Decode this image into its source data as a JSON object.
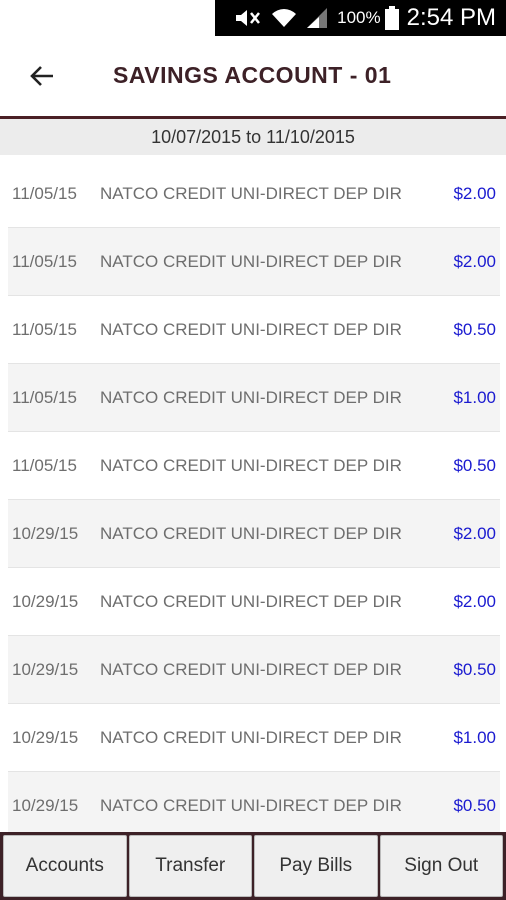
{
  "status_bar": {
    "battery_percent": "100%",
    "time": "2:54 PM",
    "icons": [
      "mute-icon",
      "wifi-icon",
      "signal-icon",
      "battery-icon"
    ]
  },
  "header": {
    "title": "SAVINGS ACCOUNT - 01",
    "back_icon": "arrow-left-icon"
  },
  "date_range": "10/07/2015 to 11/10/2015",
  "transactions": [
    {
      "date": "11/05/15",
      "description": "NATCO CREDIT UNI-DIRECT DEP DIR",
      "amount": "$2.00"
    },
    {
      "date": "11/05/15",
      "description": "NATCO CREDIT UNI-DIRECT DEP DIR",
      "amount": "$2.00"
    },
    {
      "date": "11/05/15",
      "description": "NATCO CREDIT UNI-DIRECT DEP DIR",
      "amount": "$0.50"
    },
    {
      "date": "11/05/15",
      "description": "NATCO CREDIT UNI-DIRECT DEP DIR",
      "amount": "$1.00"
    },
    {
      "date": "11/05/15",
      "description": "NATCO CREDIT UNI-DIRECT DEP DIR",
      "amount": "$0.50"
    },
    {
      "date": "10/29/15",
      "description": "NATCO CREDIT UNI-DIRECT DEP DIR",
      "amount": "$2.00"
    },
    {
      "date": "10/29/15",
      "description": "NATCO CREDIT UNI-DIRECT DEP DIR",
      "amount": "$2.00"
    },
    {
      "date": "10/29/15",
      "description": "NATCO CREDIT UNI-DIRECT DEP DIR",
      "amount": "$0.50"
    },
    {
      "date": "10/29/15",
      "description": "NATCO CREDIT UNI-DIRECT DEP DIR",
      "amount": "$1.00"
    },
    {
      "date": "10/29/15",
      "description": "NATCO CREDIT UNI-DIRECT DEP DIR",
      "amount": "$0.50"
    }
  ],
  "bottom_nav": {
    "accounts": "Accounts",
    "transfer": "Transfer",
    "pay_bills": "Pay Bills",
    "sign_out": "Sign Out"
  },
  "colors": {
    "brand_dark": "#3d2127",
    "amount_blue": "#1a1ad0"
  }
}
